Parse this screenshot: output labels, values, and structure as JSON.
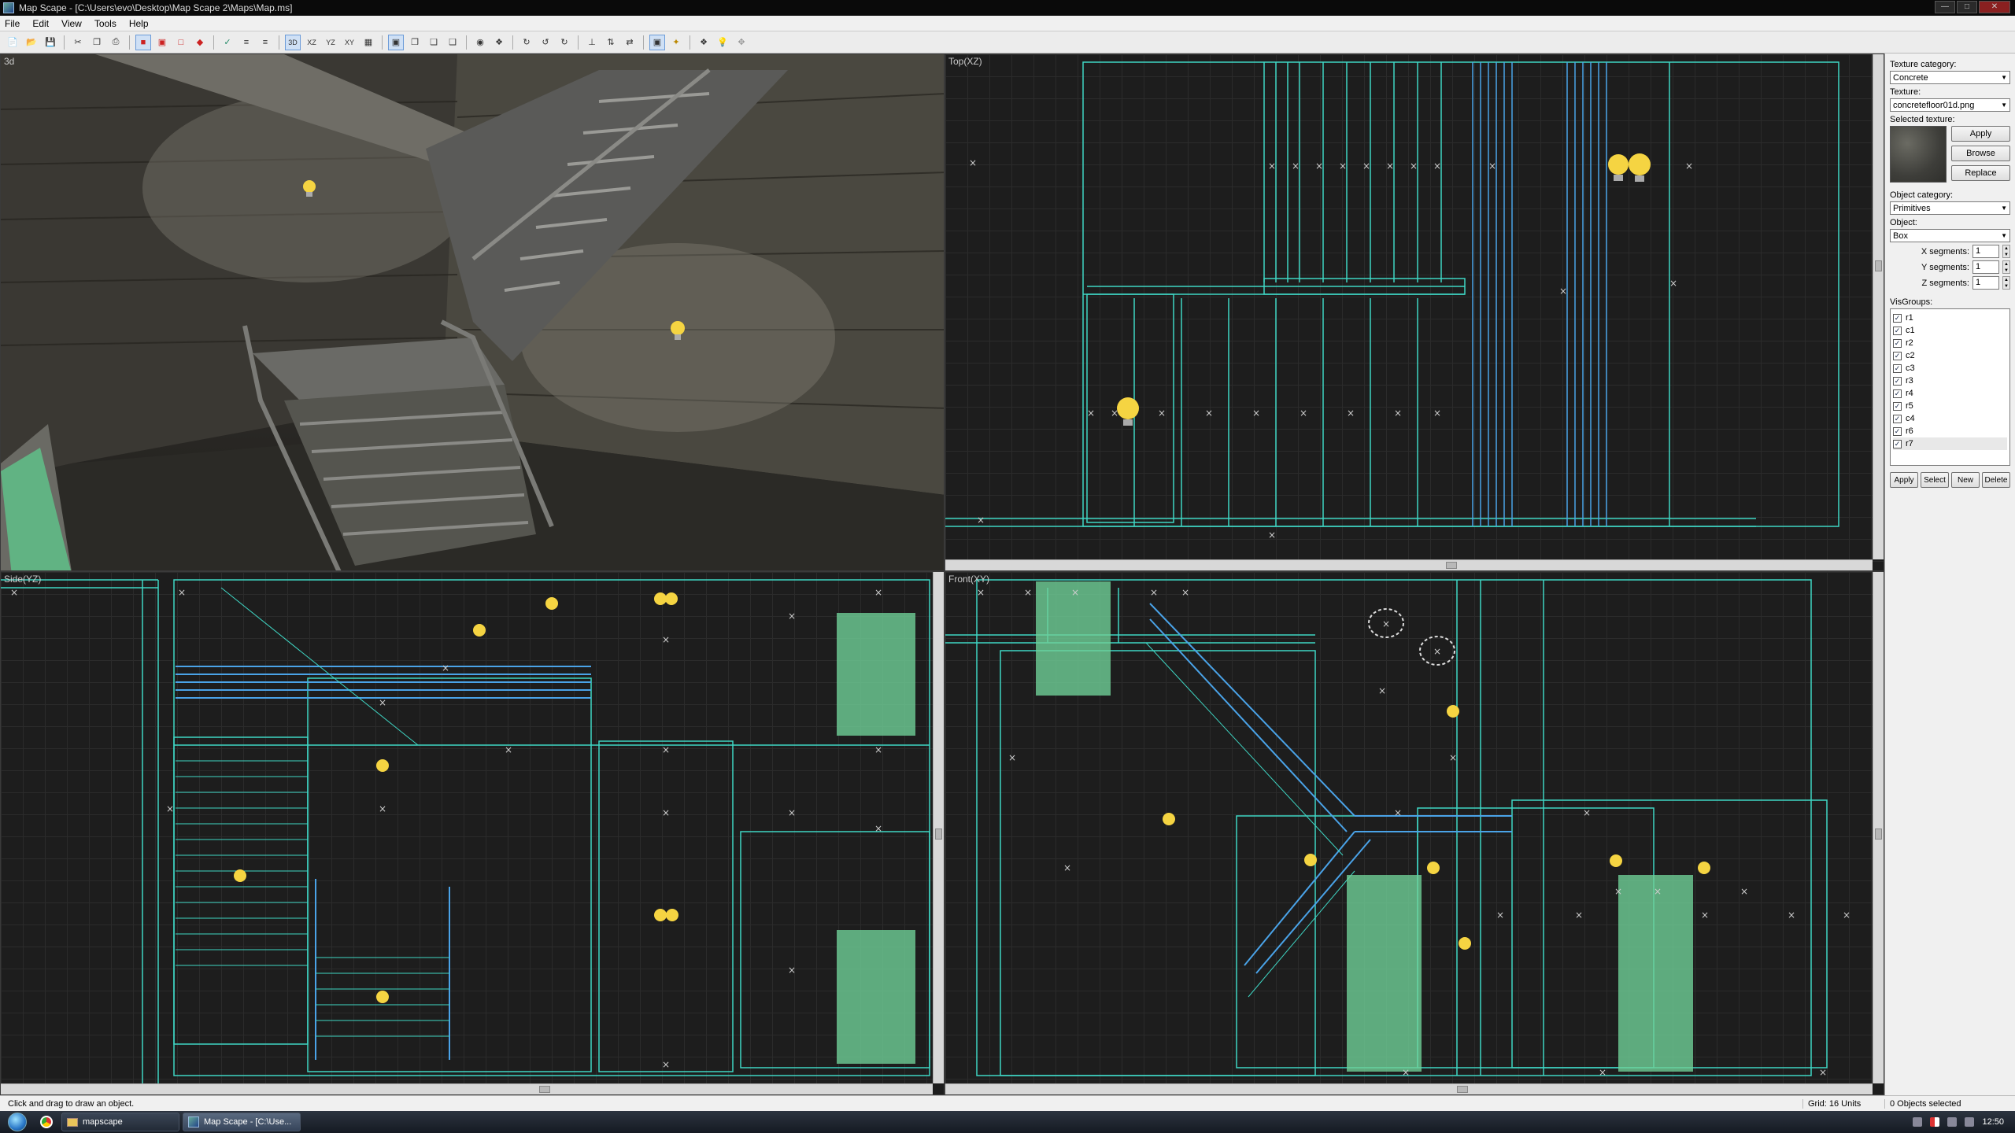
{
  "window": {
    "title": "Map Scape - [C:\\Users\\evo\\Desktop\\Map Scape 2\\Maps\\Map.ms]"
  },
  "menu": [
    "File",
    "Edit",
    "View",
    "Tools",
    "Help"
  ],
  "toolbar": {
    "icons": [
      "new-icon",
      "open-icon",
      "save-icon",
      "cut-icon",
      "copy-icon",
      "paste-icon",
      "brush-red-icon",
      "brush-red-icon",
      "brush-red-icon",
      "brush-red-icon",
      "check-icon",
      "align-icon",
      "align-icon",
      "view-3d-icon",
      "view-xz-icon",
      "view-yz-icon",
      "view-xy-icon",
      "grid-icon",
      "box-icon",
      "box-icon",
      "box-icon",
      "box-icon",
      "box-icon",
      "rotate-icon",
      "rotate-icon",
      "rotate-icon",
      "rotate-icon",
      "flip-icon",
      "flip-icon",
      "flip-icon",
      "select-icon",
      "wand-icon",
      "group-icon",
      "light-icon",
      "entity-icon"
    ],
    "labels": {
      "3d": "3D",
      "xz": "XZ",
      "yz": "YZ",
      "xy": "XY"
    }
  },
  "viewports": {
    "v3d": {
      "label": "3d"
    },
    "top": {
      "label": "Top(XZ)"
    },
    "side": {
      "label": "Side(YZ)"
    },
    "front": {
      "label": "Front(XY)"
    }
  },
  "panel": {
    "texture_category_label": "Texture category:",
    "texture_category_value": "Concrete",
    "texture_label": "Texture:",
    "texture_value": "concretefloor01d.png",
    "selected_texture_label": "Selected texture:",
    "btn_apply": "Apply",
    "btn_browse": "Browse",
    "btn_replace": "Replace",
    "object_category_label": "Object category:",
    "object_category_value": "Primitives",
    "object_label": "Object:",
    "object_value": "Box",
    "segments": [
      {
        "label": "X segments:",
        "value": "1"
      },
      {
        "label": "Y segments:",
        "value": "1"
      },
      {
        "label": "Z segments:",
        "value": "1"
      }
    ],
    "visgroups_label": "VisGroups:",
    "visgroups": [
      {
        "name": "r1",
        "checked": true
      },
      {
        "name": "c1",
        "checked": true
      },
      {
        "name": "r2",
        "checked": true
      },
      {
        "name": "c2",
        "checked": true
      },
      {
        "name": "c3",
        "checked": true
      },
      {
        "name": "r3",
        "checked": true
      },
      {
        "name": "r4",
        "checked": true
      },
      {
        "name": "r5",
        "checked": true
      },
      {
        "name": "c4",
        "checked": true
      },
      {
        "name": "r6",
        "checked": true
      },
      {
        "name": "r7",
        "checked": true
      }
    ],
    "vis_buttons": [
      "Apply",
      "Select",
      "New",
      "Delete"
    ]
  },
  "status": {
    "hint": "Click and drag to draw an object.",
    "grid": "Grid: 16 Units",
    "selection": "0 Objects selected"
  },
  "taskbar": {
    "items": [
      {
        "label": "mapscape",
        "active": false
      },
      {
        "label": "Map Scape - [C:\\Use...",
        "active": true
      }
    ],
    "clock": "12:50"
  },
  "colors": {
    "wire_cyan": "#3fd6c4",
    "wire_blue": "#4aa3e8",
    "patch_green": "#6fcf97",
    "bulb_yellow": "#f5d442",
    "grid": "#2b2b2b"
  }
}
